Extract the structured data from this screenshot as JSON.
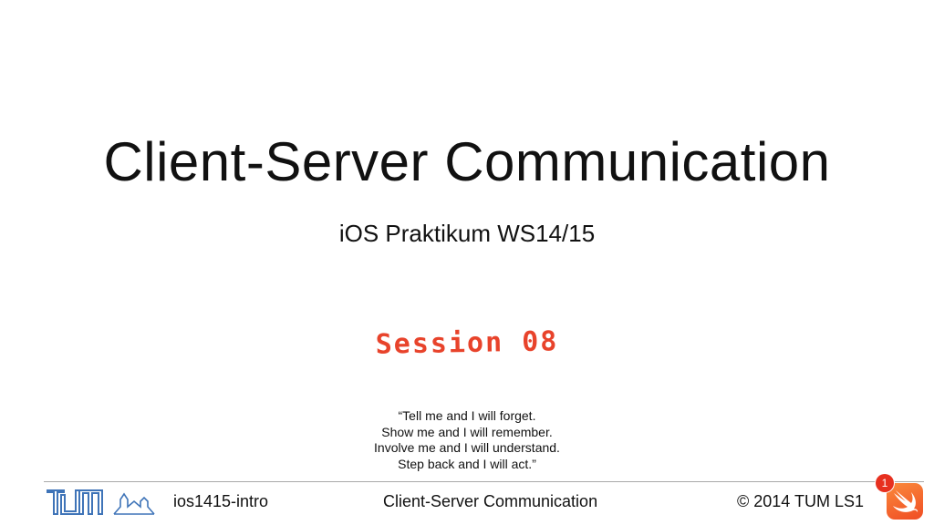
{
  "slide": {
    "title": "Client-Server Communication",
    "subtitle": "iOS Praktikum WS14/15",
    "session": "Session 08",
    "quote_lines": [
      "“Tell me and I will forget.",
      "Show me and I will remember.",
      "Involve me and I will understand.",
      "Step back and I will act.”"
    ]
  },
  "footer": {
    "left": "ios1415-intro",
    "center": "Client-Server Communication",
    "right": "© 2014 TUM LS1"
  },
  "icons": {
    "tum_logo": "tum-logo",
    "tower_logo": "university-tower-icon",
    "app_badge": "swift-icon"
  },
  "badge": {
    "count": "1"
  },
  "colors": {
    "accent": "#e8432b",
    "tum_blue": "#3f74b8",
    "swift_orange": "#f05a28",
    "badge_red": "#e7301f"
  }
}
